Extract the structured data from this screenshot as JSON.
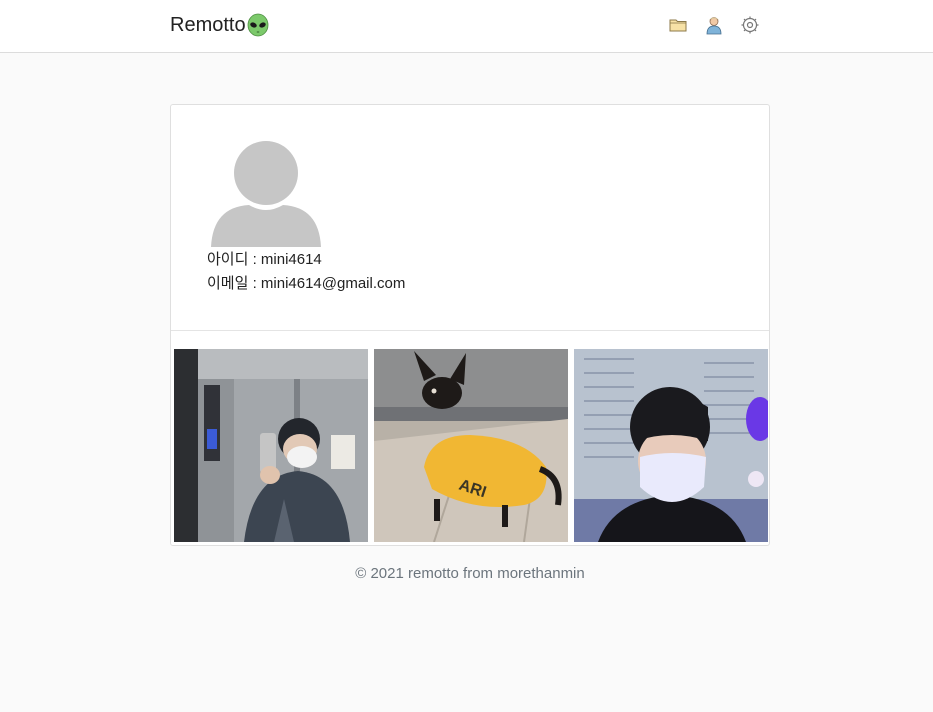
{
  "header": {
    "brand": "Remotto",
    "icons": [
      "folder-icon",
      "user-icon",
      "gear-icon"
    ]
  },
  "profile": {
    "id_label": "아이디 : ",
    "id_value": "mini4614",
    "email_label": "이메일 : ",
    "email_value": "mini4614@gmail.com"
  },
  "gallery": {
    "photos": [
      "elevator-mirror-selfie",
      "dog-in-yellow-shirt",
      "masked-selfie"
    ]
  },
  "footer": {
    "text": "© 2021 remotto from morethanmin"
  },
  "colors": {
    "background": "#fafafa",
    "card": "#ffffff",
    "border": "#dfdfdf",
    "footer_text": "#6c757d",
    "alien_green": "#7cc96b",
    "avatar_gray": "#c6c6c6"
  }
}
